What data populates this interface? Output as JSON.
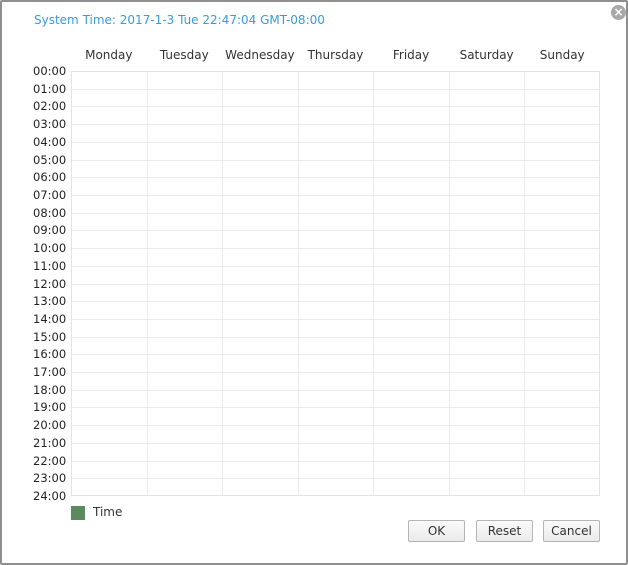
{
  "dialog": {
    "system_time": "System Time: 2017-1-3 Tue 22:47:04 GMT-08:00",
    "close_icon": "×"
  },
  "days": [
    "Monday",
    "Tuesday",
    "Wednesday",
    "Thursday",
    "Friday",
    "Saturday",
    "Sunday"
  ],
  "hours": [
    "00:00",
    "01:00",
    "02:00",
    "03:00",
    "04:00",
    "05:00",
    "06:00",
    "07:00",
    "08:00",
    "09:00",
    "10:00",
    "11:00",
    "12:00",
    "13:00",
    "14:00",
    "15:00",
    "16:00",
    "17:00",
    "18:00",
    "19:00",
    "20:00",
    "21:00",
    "22:00",
    "23:00",
    "24:00"
  ],
  "legend": {
    "label": "Time",
    "color": "#5a8a5e"
  },
  "buttons": {
    "ok": "OK",
    "reset": "Reset",
    "cancel": "Cancel"
  },
  "colors": {
    "accent_text": "#3a9bd8",
    "grid_line": "#ebebeb"
  },
  "icons": {
    "close": "close-icon"
  }
}
